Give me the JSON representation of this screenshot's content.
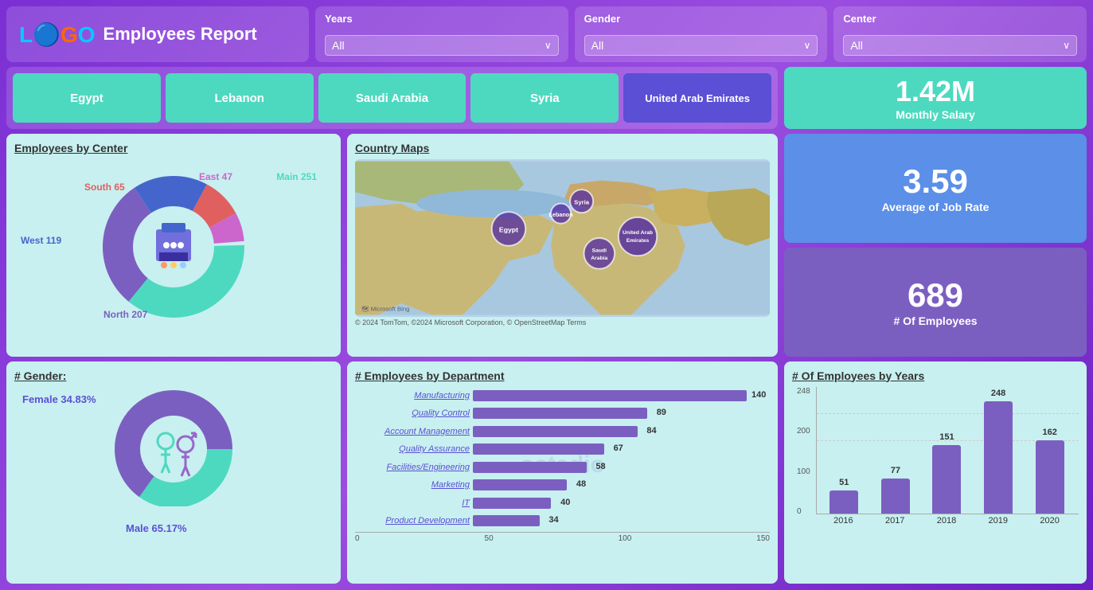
{
  "header": {
    "logo_text": "LOGO",
    "title": "Employees Report",
    "filters": {
      "years": {
        "label": "Years",
        "value": "All"
      },
      "gender": {
        "label": "Gender",
        "value": "All"
      },
      "center": {
        "label": "Center",
        "value": "All"
      }
    }
  },
  "countries": {
    "tabs": [
      "Egypt",
      "Lebanon",
      "Saudi Arabia",
      "Syria",
      "United Arab Emirates"
    ],
    "active": "United Arab Emirates"
  },
  "stats": {
    "monthly_salary": {
      "value": "1.42M",
      "label": "Monthly Salary"
    },
    "avg_job_rate": {
      "value": "3.59",
      "label": "Average of Job Rate"
    },
    "num_employees": {
      "value": "689",
      "label": "# Of Employees"
    }
  },
  "employees_by_center": {
    "title": "Employees by Center",
    "segments": [
      {
        "label": "Main 251",
        "color": "#4dd9c0",
        "value": 251,
        "pct": 36
      },
      {
        "label": "North 207",
        "color": "#7b5fc0",
        "value": 207,
        "pct": 30
      },
      {
        "label": "West 119",
        "color": "#4466cc",
        "value": 119,
        "pct": 17
      },
      {
        "label": "South 65",
        "color": "#e06060",
        "value": 65,
        "pct": 9
      },
      {
        "label": "East 47",
        "color": "#cc66cc",
        "value": 47,
        "pct": 7
      }
    ]
  },
  "map": {
    "title": "Country Maps",
    "bubbles": [
      {
        "country": "Egypt",
        "x": 34,
        "y": 38,
        "size": 50
      },
      {
        "country": "Syria",
        "x": 52,
        "y": 20,
        "size": 35
      },
      {
        "country": "Lebanon",
        "x": 46,
        "y": 40,
        "size": 30
      },
      {
        "country": "United Arab Emirates",
        "x": 63,
        "y": 43,
        "size": 55
      },
      {
        "country": "Saudi Arabia",
        "x": 55,
        "y": 58,
        "size": 45
      }
    ],
    "footer": "© 2024 TomTom, ©2024 Microsoft Corporation, © OpenStreetMap Terms"
  },
  "gender": {
    "title": "# Gender:",
    "female_pct": "34.83%",
    "male_pct": "65.17%",
    "female_label": "Female 34.83%",
    "male_label": "Male 65.17%",
    "female_color": "#4dd9c0",
    "male_color": "#7b5fc0"
  },
  "dept_chart": {
    "title": "# Employees by Department",
    "max": 150,
    "axis": [
      "0",
      "50",
      "100",
      "150"
    ],
    "bars": [
      {
        "label": "Manufacturing",
        "value": 140
      },
      {
        "label": "Quality Control",
        "value": 89
      },
      {
        "label": "Account Management",
        "value": 84
      },
      {
        "label": "Quality Assurance",
        "value": 67
      },
      {
        "label": "Facilities/Engineering",
        "value": 58
      },
      {
        "label": "Marketing",
        "value": 48
      },
      {
        "label": "IT",
        "value": 40
      },
      {
        "label": "Product Development",
        "value": 34
      }
    ]
  },
  "yearly_chart": {
    "title": "# Of Employees by Years",
    "y_axis": [
      "0",
      "100",
      "200"
    ],
    "bars": [
      {
        "year": "2016",
        "value": 51
      },
      {
        "year": "2017",
        "value": 77
      },
      {
        "year": "2018",
        "value": 151
      },
      {
        "year": "2019",
        "value": 248
      },
      {
        "year": "2020",
        "value": 162
      }
    ],
    "max": 280
  }
}
